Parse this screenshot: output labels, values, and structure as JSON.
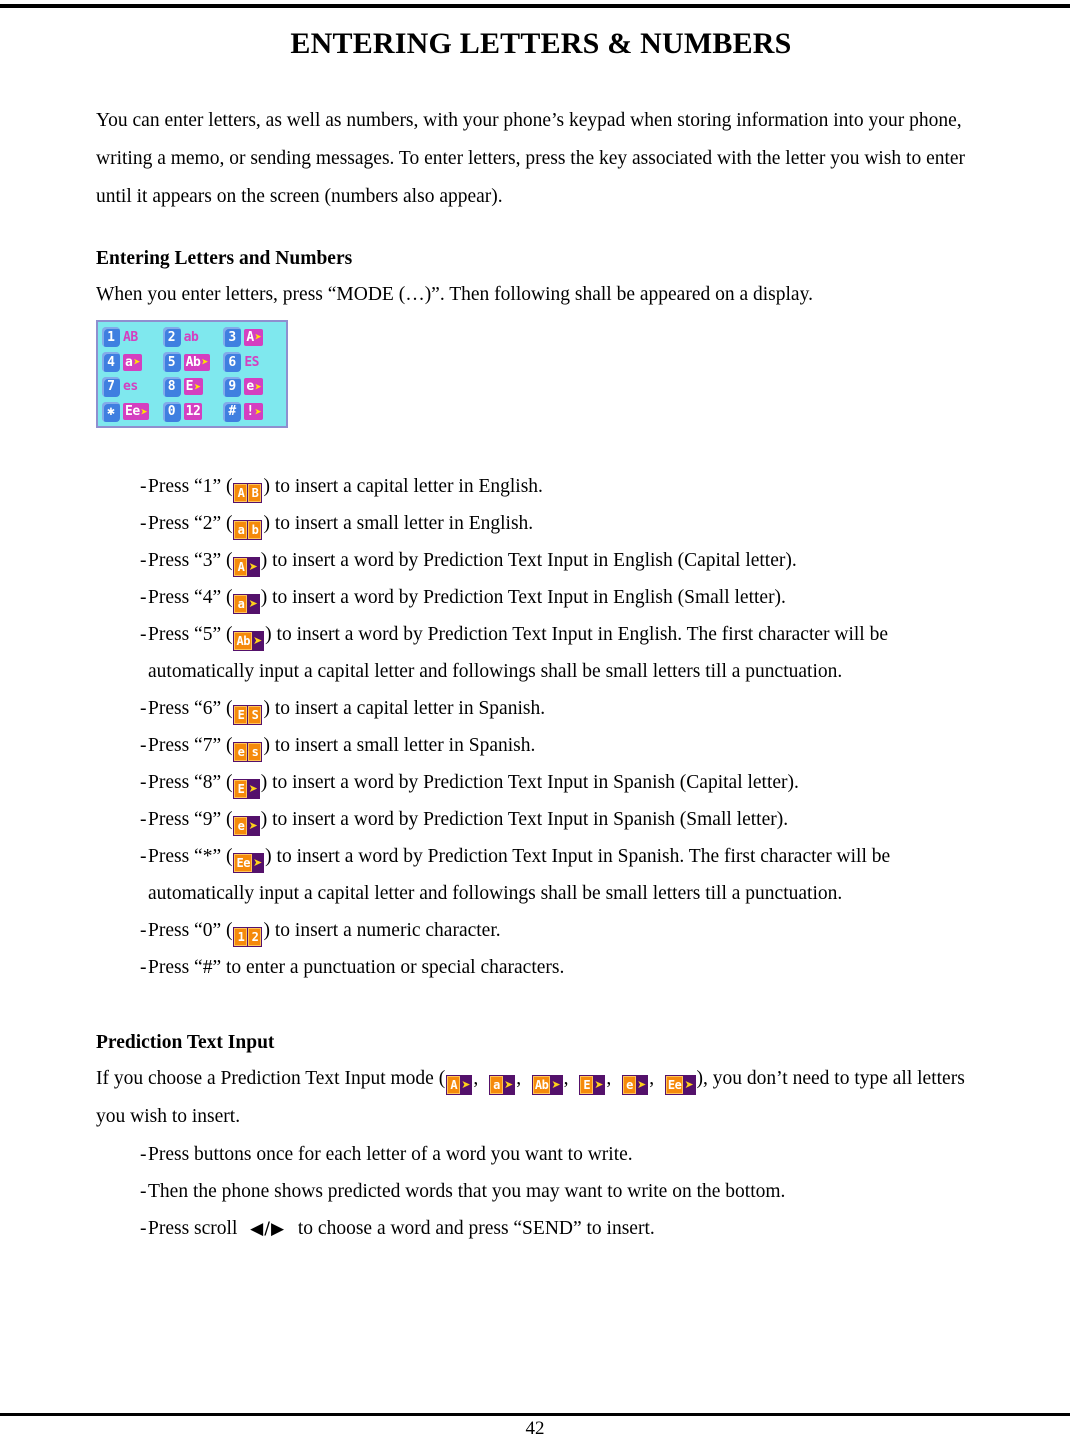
{
  "document": {
    "title": "ENTERING LETTERS & NUMBERS",
    "page_number": "42"
  },
  "intro": {
    "paragraph": "You can enter letters, as well as numbers, with your phone’s keypad when storing information into your phone, writing a memo, or sending messages. To enter letters, press the key associated with the letter you wish to enter until it appears on the screen (numbers also appear)."
  },
  "section_entering": {
    "heading": "Entering Letters and Numbers",
    "intro": "When you enter letters, press “MODE (…)”. Then following shall be appeared on a display.",
    "lcd_screen": {
      "name": "mode-selection-display",
      "background_color": "#7fe8ee",
      "key_color": "#3f7fe0",
      "label_color": "#d43fc0",
      "arrow_color": "#ffe400",
      "cells": [
        {
          "key": "1",
          "label": "AB",
          "boxed": false,
          "arrow": false
        },
        {
          "key": "2",
          "label": "ab",
          "boxed": false,
          "arrow": false
        },
        {
          "key": "3",
          "label": "A",
          "boxed": true,
          "arrow": true
        },
        {
          "key": "4",
          "label": "a",
          "boxed": true,
          "arrow": true
        },
        {
          "key": "5",
          "label": "Ab",
          "boxed": true,
          "arrow": true
        },
        {
          "key": "6",
          "label": "ES",
          "boxed": false,
          "arrow": false
        },
        {
          "key": "7",
          "label": "es",
          "boxed": false,
          "arrow": false
        },
        {
          "key": "8",
          "label": "E",
          "boxed": true,
          "arrow": true
        },
        {
          "key": "9",
          "label": "e",
          "boxed": true,
          "arrow": true
        },
        {
          "key": "✱",
          "label": "Ee",
          "boxed": true,
          "arrow": true
        },
        {
          "key": "0",
          "label": "12",
          "boxed": true,
          "arrow": false
        },
        {
          "key": "#",
          "label": "!",
          "boxed": true,
          "arrow": true
        }
      ]
    },
    "bullets": [
      {
        "dash": "-",
        "pre": "Press “1” (",
        "icon": {
          "name": "mode-icon-AB",
          "glyphs": [
            "A",
            "B"
          ],
          "arrow": false
        },
        "post": ") to insert a capital letter in English."
      },
      {
        "dash": "-",
        "pre": "Press “2” (",
        "icon": {
          "name": "mode-icon-ab",
          "glyphs": [
            "a",
            "b"
          ],
          "arrow": false
        },
        "post": ") to insert a small letter in English."
      },
      {
        "dash": "-",
        "pre": "Press “3” (",
        "icon": {
          "name": "mode-icon-A-arrow",
          "glyphs": [
            "A"
          ],
          "arrow": true
        },
        "post": ") to insert a word by Prediction Text Input in English (Capital letter)."
      },
      {
        "dash": "-",
        "pre": "Press “4” (",
        "icon": {
          "name": "mode-icon-a-arrow",
          "glyphs": [
            "a"
          ],
          "arrow": true
        },
        "post": ") to insert a word by Prediction Text Input in English (Small letter)."
      },
      {
        "dash": "-",
        "pre": "Press “5” (",
        "icon": {
          "name": "mode-icon-Ab-arrow",
          "glyphs": [
            "Ab"
          ],
          "arrow": true
        },
        "post": ") to insert a word by Prediction Text Input in English. The first character will be automatically input a capital letter and followings shall be small letters till a punctuation."
      },
      {
        "dash": "-",
        "pre": "Press “6” (",
        "icon": {
          "name": "mode-icon-ES",
          "glyphs": [
            "E",
            "S"
          ],
          "arrow": false
        },
        "post": ") to insert a capital letter in Spanish."
      },
      {
        "dash": "-",
        "pre": "Press “7” (",
        "icon": {
          "name": "mode-icon-es",
          "glyphs": [
            "e",
            "s"
          ],
          "arrow": false
        },
        "post": ") to insert a small letter in Spanish."
      },
      {
        "dash": "-",
        "pre": "Press “8” (",
        "icon": {
          "name": "mode-icon-E-arrow",
          "glyphs": [
            "E"
          ],
          "arrow": true
        },
        "post": ") to insert a word by Prediction Text Input in Spanish (Capital letter)."
      },
      {
        "dash": "-",
        "pre": "Press “9” (",
        "icon": {
          "name": "mode-icon-e-arrow",
          "glyphs": [
            "e"
          ],
          "arrow": true
        },
        "post": ") to insert a word by Prediction Text Input in Spanish (Small letter)."
      },
      {
        "dash": "-",
        "pre": "Press “*” (",
        "icon": {
          "name": "mode-icon-Ee-arrow",
          "glyphs": [
            "Ee"
          ],
          "arrow": true
        },
        "post": ") to insert a word by Prediction Text Input in Spanish. The first character will be automatically input a capital letter and followings shall be small letters till a punctuation."
      },
      {
        "dash": "-",
        "pre": "Press “0” (",
        "icon": {
          "name": "mode-icon-12",
          "glyphs": [
            "1",
            "2"
          ],
          "arrow": false
        },
        "post": ") to insert a numeric character."
      },
      {
        "dash": "-",
        "pre": "Press “#” to enter a punctuation or special characters.",
        "icon": null,
        "post": ""
      }
    ]
  },
  "section_prediction": {
    "heading": "Prediction Text Input",
    "intro_pre": "If you choose a Prediction Text Input mode (",
    "intro_post": "), you don’t need to type all letters you wish to insert.",
    "mode_icons": [
      {
        "name": "mode-icon-A-arrow",
        "glyphs": [
          "A"
        ],
        "arrow": true
      },
      {
        "name": "mode-icon-a-arrow",
        "glyphs": [
          "a"
        ],
        "arrow": true
      },
      {
        "name": "mode-icon-Ab-arrow",
        "glyphs": [
          "Ab"
        ],
        "arrow": true
      },
      {
        "name": "mode-icon-E-arrow",
        "glyphs": [
          "E"
        ],
        "arrow": true
      },
      {
        "name": "mode-icon-e-arrow",
        "glyphs": [
          "e"
        ],
        "arrow": true
      },
      {
        "name": "mode-icon-Ee-arrow",
        "glyphs": [
          "Ee"
        ],
        "arrow": true
      }
    ],
    "bullets": [
      {
        "dash": "-",
        "text": "Press buttons once for each letter of a word you want to write."
      },
      {
        "dash": "-",
        "text": "Then the phone shows predicted words that you may want to write on the bottom."
      },
      {
        "dash": "-",
        "text_pre": "Press scroll",
        "scroll_glyph": "◀/▶",
        "text_post": "to choose a word and press “SEND” to insert."
      }
    ]
  }
}
